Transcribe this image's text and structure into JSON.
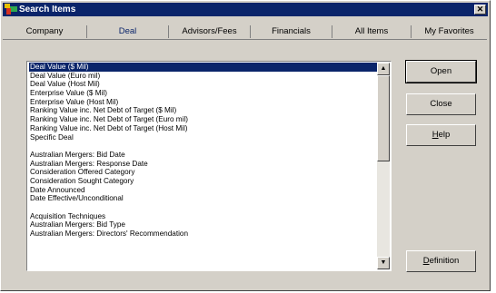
{
  "window": {
    "title": "Search Items",
    "close_glyph": "✕"
  },
  "tabs": [
    {
      "label": "Company",
      "active": false
    },
    {
      "label": "Deal",
      "active": true
    },
    {
      "label": "Advisors/Fees",
      "active": false
    },
    {
      "label": "Financials",
      "active": false
    },
    {
      "label": "All Items",
      "active": false
    },
    {
      "label": "My Favorites",
      "active": false
    }
  ],
  "items": [
    "Deal Value ($ Mil)",
    "Deal Value (Euro mil)",
    "Deal Value (Host Mil)",
    "Enterprise Value ($ Mil)",
    "Enterprise Value (Host Mil)",
    "Ranking Value inc. Net Debt of Target ($ Mil)",
    "Ranking Value inc. Net Debt of Target (Euro mil)",
    "Ranking Value inc. Net Debt of Target (Host Mil)",
    "Specific Deal",
    "",
    "Australian Mergers: Bid Date",
    "Australian Mergers: Response Date",
    "Consideration Offered Category",
    "Consideration Sought Category",
    "Date Announced",
    "Date Effective/Unconditional",
    "",
    "Acquisition Techniques",
    "Australian Mergers: Bid Type",
    "Australian Mergers: Directors' Recommendation"
  ],
  "selected_index": 0,
  "scroll": {
    "up_glyph": "▲",
    "down_glyph": "▼"
  },
  "buttons": {
    "open": "Open",
    "close": "Close",
    "help": "Help",
    "definition": "Definition"
  },
  "colors": {
    "titlebar": "#0a246a",
    "selection": "#0a246a",
    "face": "#d4d0c8"
  }
}
